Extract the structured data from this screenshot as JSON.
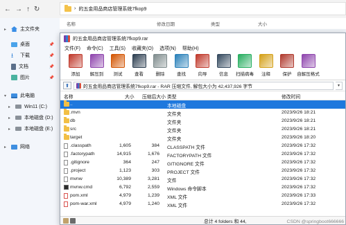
{
  "explorer": {
    "address": "的五金用品商店管理系统7fkop9",
    "columns": {
      "name": "名称",
      "modified": "修改日期",
      "type": "类型",
      "size": "大小"
    },
    "sidebar": [
      {
        "label": "主文件夹",
        "icon": "home-icon",
        "caret": "▸"
      },
      {
        "label": "桌面",
        "icon": "desktop-icon",
        "pinned": true
      },
      {
        "label": "下载",
        "icon": "download-icon",
        "pinned": true
      },
      {
        "label": "文档",
        "icon": "document-icon",
        "pinned": true
      },
      {
        "label": "图片",
        "icon": "picture-icon",
        "pinned": true
      },
      {
        "label": "此电脑",
        "icon": "pc-icon",
        "caret": "▾"
      },
      {
        "label": "Win11 (C:)",
        "icon": "drive-icon",
        "caret": "▸"
      },
      {
        "label": "本地磁盘 (D:)",
        "icon": "drive-icon",
        "caret": "▸"
      },
      {
        "label": "本地磁盘 (E:)",
        "icon": "drive-icon",
        "caret": "▸"
      },
      {
        "label": "网络",
        "icon": "network-icon",
        "caret": "▸"
      }
    ]
  },
  "rar": {
    "title": "的五金用品商店管理系统7fkop9.rar",
    "menu": [
      "文件(F)",
      "命令(C)",
      "工具(S)",
      "收藏夹(O)",
      "选项(N)",
      "帮助(H)"
    ],
    "toolbar": [
      {
        "label": "添加",
        "icon": "add-icon",
        "color": "#c0392b"
      },
      {
        "label": "解压到",
        "icon": "extract-icon",
        "color": "#8e44ad"
      },
      {
        "label": "测试",
        "icon": "test-icon",
        "color": "#d35400"
      },
      {
        "label": "查看",
        "icon": "view-icon",
        "color": "#2c3e50"
      },
      {
        "label": "删除",
        "icon": "delete-icon",
        "color": "#7f8c8d"
      },
      {
        "label": "查找",
        "icon": "find-icon",
        "color": "#2980b9"
      },
      {
        "label": "向导",
        "icon": "wizard-icon",
        "color": "#c0392b"
      },
      {
        "label": "信息",
        "icon": "info-icon",
        "color": "#34495e"
      },
      {
        "label": "扫描病毒",
        "icon": "virus-scan-icon",
        "color": "#27ae60"
      },
      {
        "label": "注释",
        "icon": "comment-icon",
        "color": "#d4a017"
      },
      {
        "label": "保护",
        "icon": "protect-icon",
        "color": "#b03a2e"
      },
      {
        "label": "自解压格式",
        "icon": "sfx-icon",
        "color": "#8e44ad"
      }
    ],
    "path": "的五金用品商店管理系统7fkop9.rar - RAR 压缩文件, 解包大小为 42,437,926 字节",
    "columns": {
      "name": "名称",
      "size": "大小",
      "packed": "压缩后大小",
      "type": "类型",
      "modified": "修改时间"
    },
    "files": [
      {
        "name": "..",
        "size": "",
        "packed": "",
        "type": "本地磁盘",
        "modified": "",
        "icon": "folder-icon",
        "selected": true
      },
      {
        "name": ".mvn",
        "size": "",
        "packed": "",
        "type": "文件夹",
        "modified": "2023/9/26 18:21",
        "icon": "folder-icon"
      },
      {
        "name": "db",
        "size": "",
        "packed": "",
        "type": "文件夹",
        "modified": "2023/9/26 18:21",
        "icon": "folder-icon"
      },
      {
        "name": "src",
        "size": "",
        "packed": "",
        "type": "文件夹",
        "modified": "2023/9/26 18:21",
        "icon": "folder-icon"
      },
      {
        "name": "target",
        "size": "",
        "packed": "",
        "type": "文件夹",
        "modified": "2023/9/26 18:20",
        "icon": "folder-icon"
      },
      {
        "name": ".classpath",
        "size": "1,605",
        "packed": "384",
        "type": "CLASSPATH 文件",
        "modified": "2023/9/26 17:32",
        "icon": "file-icon"
      },
      {
        "name": ".factorypath",
        "size": "14,915",
        "packed": "1,676",
        "type": "FACTORYPATH 文件",
        "modified": "2023/9/26 17:32",
        "icon": "file-icon"
      },
      {
        "name": ".gitignore",
        "size": "364",
        "packed": "247",
        "type": "GITIGNORE 文件",
        "modified": "2023/9/26 17:32",
        "icon": "file-icon"
      },
      {
        "name": ".project",
        "size": "1,123",
        "packed": "303",
        "type": "PROJECT 文件",
        "modified": "2023/9/26 17:32",
        "icon": "file-icon"
      },
      {
        "name": "mvnw",
        "size": "10,389",
        "packed": "3,281",
        "type": "文件",
        "modified": "2023/9/26 17:32",
        "icon": "file-icon"
      },
      {
        "name": "mvnw.cmd",
        "size": "6,792",
        "packed": "2,559",
        "type": "Windows 命令脚本",
        "modified": "2023/9/26 17:32",
        "icon": "cmd-icon"
      },
      {
        "name": "pom.xml",
        "size": "4,979",
        "packed": "1,239",
        "type": "XML 文件",
        "modified": "2023/9/26 17:33",
        "icon": "xml-icon"
      },
      {
        "name": "pom-war.xml",
        "size": "4,979",
        "packed": "1,240",
        "type": "XML 文件",
        "modified": "2023/9/26 17:32",
        "icon": "xml-icon"
      }
    ],
    "status": "总计 4 folders 和 44,",
    "watermark": "CSDN @springboot666666"
  }
}
